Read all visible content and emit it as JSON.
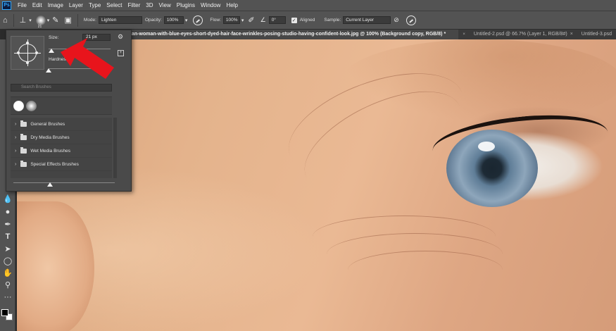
{
  "menu": [
    "File",
    "Edit",
    "Image",
    "Layer",
    "Type",
    "Select",
    "Filter",
    "3D",
    "View",
    "Plugins",
    "Window",
    "Help"
  ],
  "ps_logo": "Ps",
  "options": {
    "brush_size_num": "21",
    "mode_label": "Mode:",
    "mode_value": "Lighten",
    "opacity_label": "Opacity:",
    "opacity_value": "100%",
    "flow_label": "Flow:",
    "flow_value": "100%",
    "angle_value": "0°",
    "aligned_label": "Aligned",
    "sample_label": "Sample:",
    "sample_value": "Current Layer"
  },
  "tabs": [
    {
      "label": "an-woman-with-blue-eyes-short-dyed-hair-face-wrinkles-posing-studio-having-confident-look.jpg @ 100% (Background copy, RGB/8) *",
      "active": true
    },
    {
      "label": "Untitled-2.psd @ 66.7% (Layer 1, RGB/8#)",
      "active": false
    },
    {
      "label": "Untitled-3.psd",
      "active": false
    }
  ],
  "brush_panel": {
    "size_label": "Size:",
    "size_value": "21 px",
    "size_fraction": 0.05,
    "hardness_label": "Hardness:",
    "hardness_fraction": 0.0,
    "search_placeholder": "Search Brushes",
    "folders": [
      "General Brushes",
      "Dry Media Brushes",
      "Wet Media Brushes",
      "Special Effects Brushes"
    ]
  },
  "tools": [
    "move-icon",
    "rectangle-select-icon",
    "lasso-icon",
    "quick-select-icon",
    "crop-icon",
    "frame-icon",
    "eyedropper-icon",
    "healing-brush-icon",
    "brush-icon",
    "clone-stamp-icon",
    "history-brush-icon",
    "eraser-icon",
    "gradient-icon",
    "blur-drop-icon",
    "dodge-icon",
    "pen-icon",
    "type-icon",
    "path-select-icon",
    "ellipse-icon",
    "hand-icon",
    "zoom-icon",
    "more-icon"
  ],
  "colors": {
    "foreground": "#000000",
    "background": "#ffffff",
    "arrow": "#e8141c",
    "ui_panel": "#535353"
  }
}
